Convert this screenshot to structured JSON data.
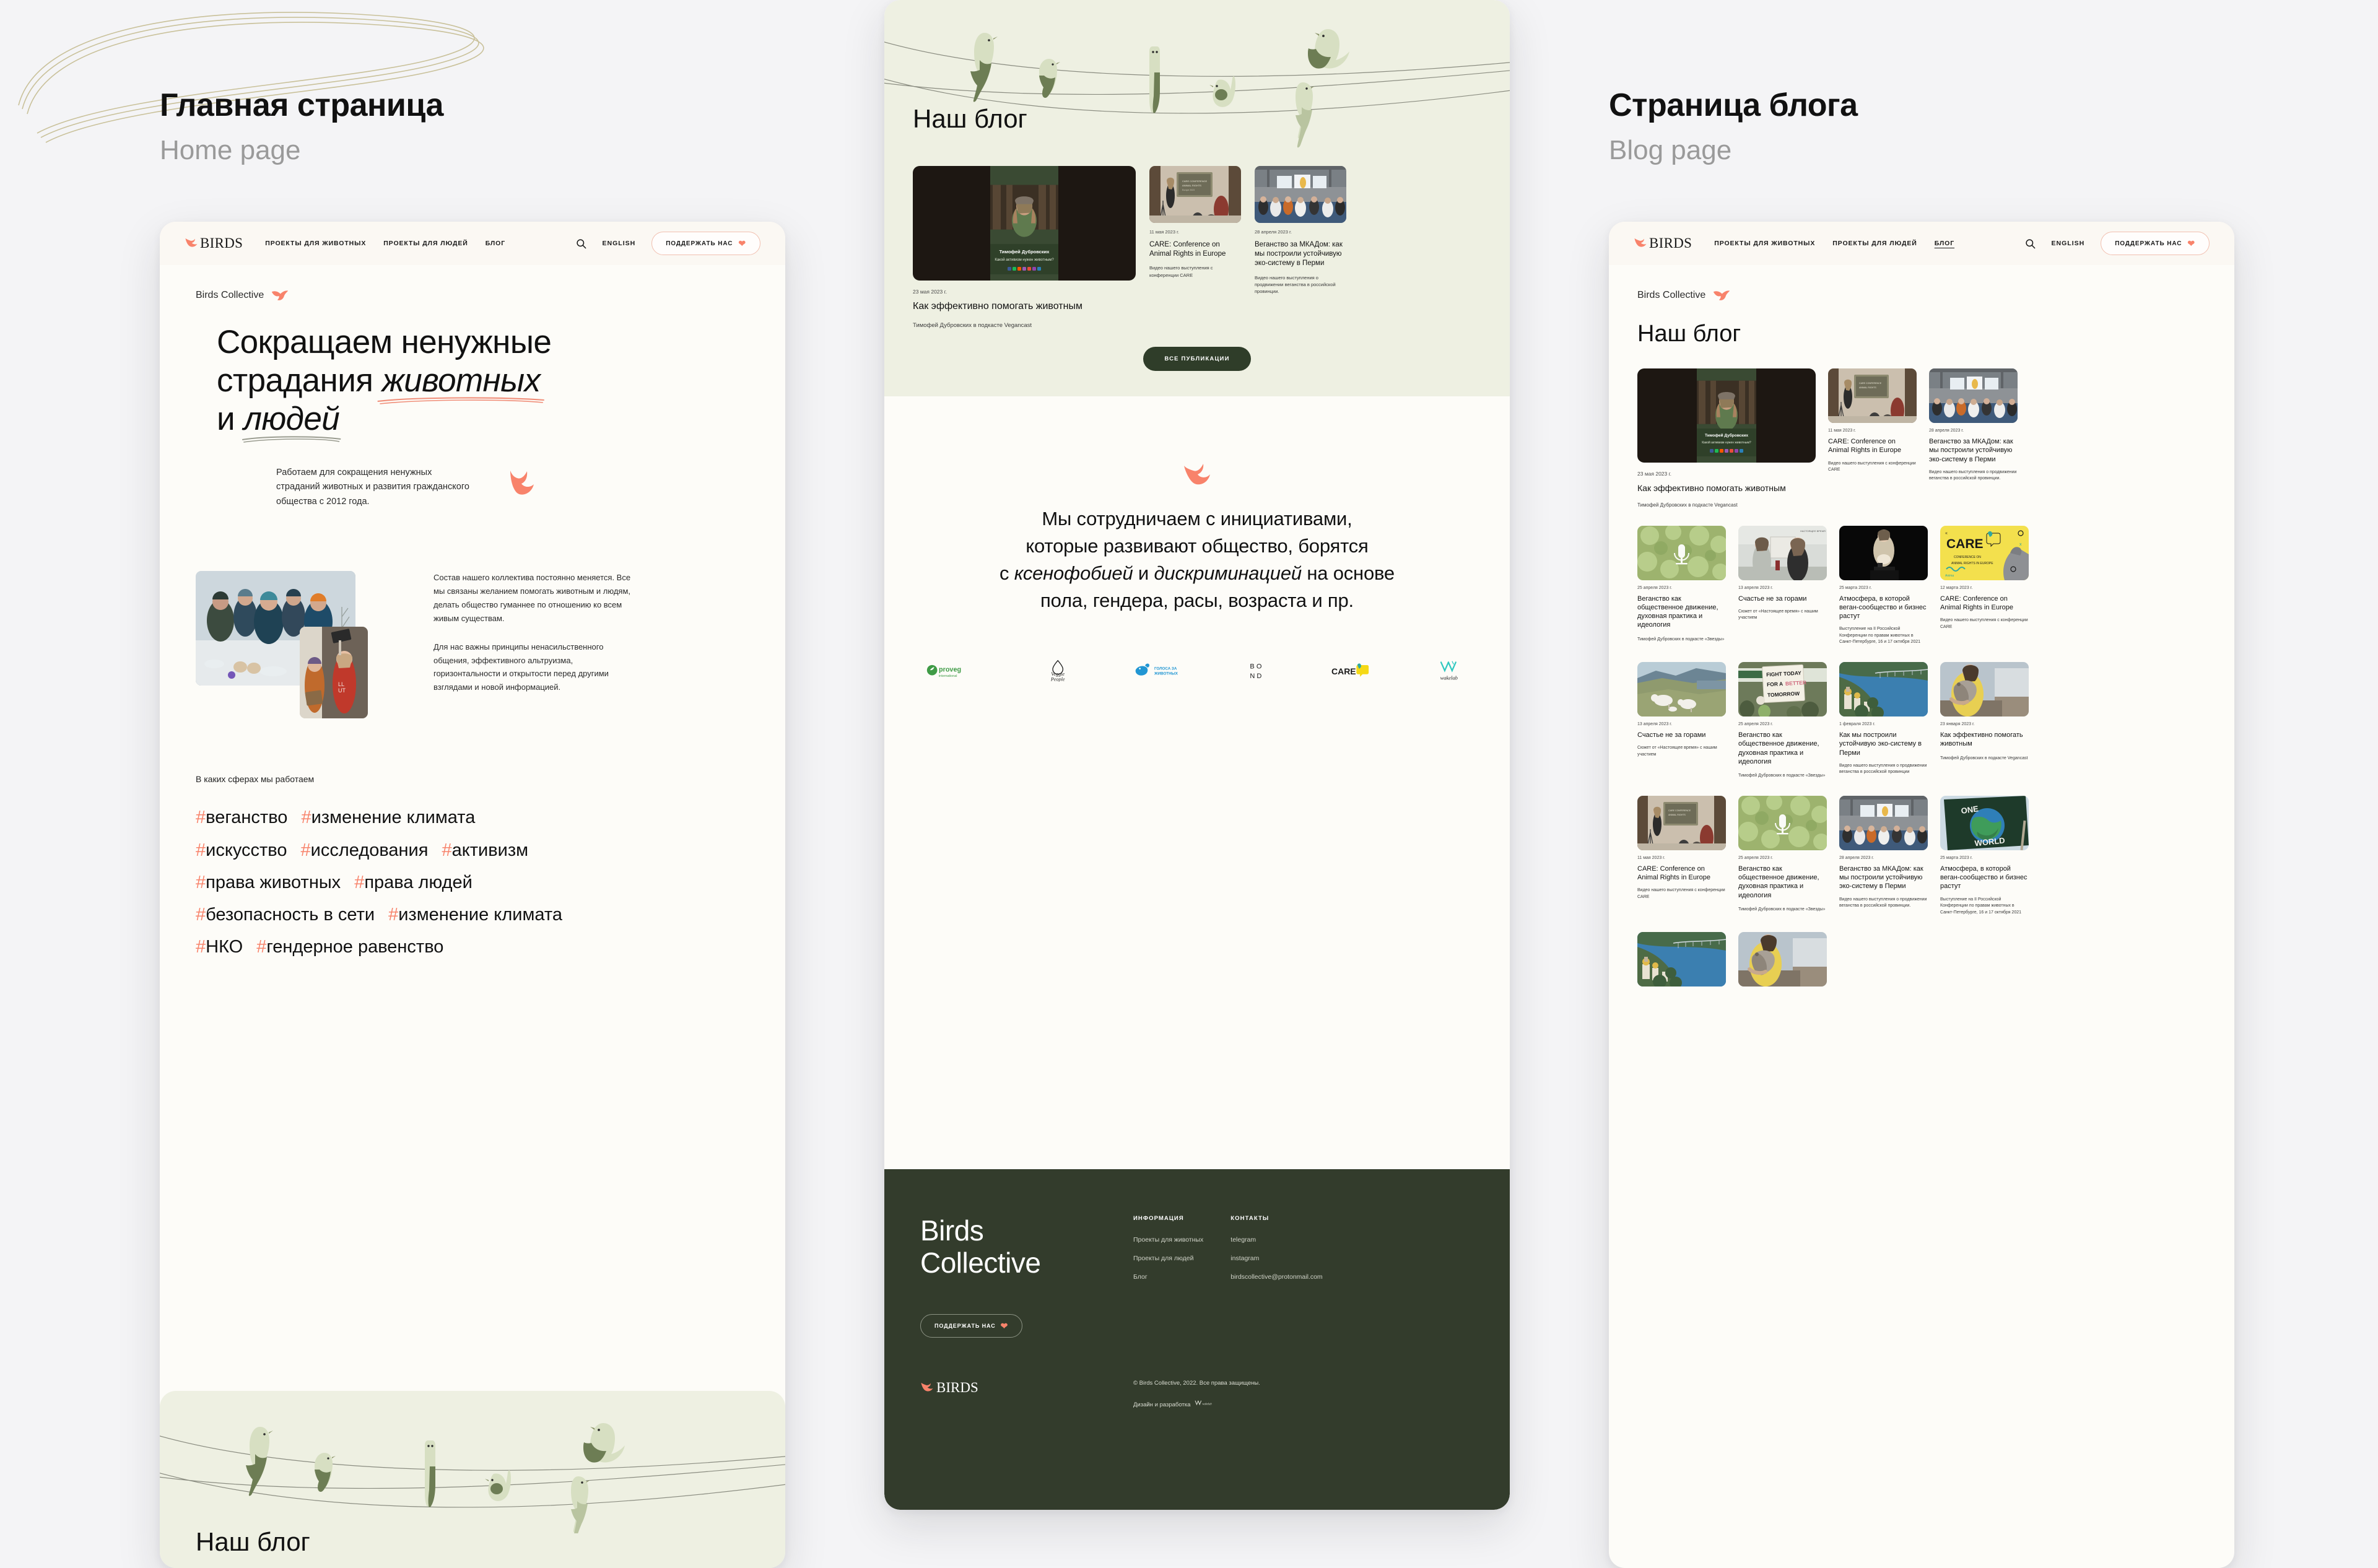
{
  "labels": {
    "home": {
      "title": "Главная страница",
      "subtitle": "Home page"
    },
    "blog": {
      "title": "Страница блога",
      "subtitle": "Blog page"
    }
  },
  "colors": {
    "accent": "#f8836b",
    "dark_green": "#333c2c",
    "pale_green": "#eef0e2",
    "cream": "#fdfcf8",
    "page_bg": "#f4f4f6"
  },
  "header": {
    "logo_text": "BIRDS",
    "logo_icon": "bird-logo-icon",
    "nav": [
      {
        "label": "Проекты для животных",
        "active": false
      },
      {
        "label": "Проекты для людей",
        "active": false
      },
      {
        "label": "Блог",
        "active": false
      }
    ],
    "nav_blogpage": [
      {
        "label": "Проекты для животных",
        "active": false
      },
      {
        "label": "Проекты для людей",
        "active": false
      },
      {
        "label": "Блог",
        "active": true
      }
    ],
    "search_icon": "search-icon",
    "language": "ENGLISH",
    "support_button": "Поддержать нас",
    "heart_icon": "heart-icon"
  },
  "hero": {
    "eyebrow": "Birds Collective",
    "eyebrow_icon": "bird-flying-icon",
    "title_line1": "Сокращаем ненужные",
    "title_line2_plain": "страдания ",
    "title_line2_em": "животных",
    "title_line3_plain": "и ",
    "title_line3_em": "людей",
    "subtitle": "Работаем для сокращения ненужных страданий животных и развития гражданского общества с 2012 года."
  },
  "about": {
    "p1": "Состав нашего коллектива постоянно меняется. Все мы связаны желанием помогать животным и людям, делать общество гуманнее по отношению ко всем живым существам.",
    "p2": "Для нас важны принципы ненасильственного общения, эффективного альтруизма, горизонтальности и открытости перед другими взглядами и новой информацией."
  },
  "tags": {
    "caption": "В каких сферах мы работаем",
    "rows": [
      [
        "веганство",
        "изменение климата"
      ],
      [
        "искусство",
        "исследования",
        "активизм"
      ],
      [
        "права животных",
        "права людей"
      ],
      [
        "безопасность в сети",
        "изменение климата"
      ],
      [
        "НКО",
        "гендерное равенство"
      ]
    ]
  },
  "blog_section": {
    "title": "Наш блог",
    "all_button": "Все публикации",
    "featured": {
      "date": "23 мая 2023 г.",
      "title": "Как эффективно помогать животным",
      "meta": "Тимофей Дубровских в подкасте Vegancast",
      "cover_name": "Тимофей Дубровских",
      "cover_question": "Какой активизм нужен животным?"
    },
    "side_cards": [
      {
        "date": "11 мая 2023 г.",
        "title": "CARE: Conference on Animal Rights in Europe",
        "desc": "Видео нашего выступления с конференции CARE"
      },
      {
        "date": "28 апреля 2023 г.",
        "title": "Веганство за МКАДом: как мы построили устойчивую эко-систему в Перми",
        "desc": "Видео нашего выступления о продвижении веганства в российской провинции."
      }
    ]
  },
  "collab": {
    "icon": "bird-flying-icon",
    "line1": "Мы сотрудничаем с инициативами,",
    "line2": "которые развивают общество, борятся",
    "line3_a": "с ",
    "line3_em1": "ксенофобией",
    "line3_b": " и ",
    "line3_em2": "дискриминацией",
    "line3_c": " на основе",
    "line4": "пола, гендера, расы, возраста и пр.",
    "partners": [
      {
        "name": "proveg international",
        "main": "proveg",
        "sub": "international"
      },
      {
        "name": "Veggie People",
        "main": "Veggie",
        "sub": "People"
      },
      {
        "name": "Голоса за животных",
        "main": "ГОЛОСА ЗА",
        "sub": "ЖИВОТНЫХ"
      },
      {
        "name": "BOND",
        "main": "B O",
        "sub": "N D"
      },
      {
        "name": "CARE",
        "main": "CARE",
        "sub": ""
      },
      {
        "name": "wakelab",
        "main": "wakelab",
        "sub": ""
      }
    ]
  },
  "footer": {
    "brand_line1": "Birds",
    "brand_line2": "Collective",
    "support_button": "Поддержать нас",
    "col_info_title": "Информация",
    "col_info_links": [
      "Проекты для животных",
      "Проекты для людей",
      "Блог"
    ],
    "col_contacts_title": "Контакты",
    "col_contacts_links": [
      "telegram",
      "instagram",
      "birdscollective@protonmail.com"
    ],
    "logo_text": "BIRDS",
    "copyright": "© Birds Collective, 2022. Все права защищены.",
    "credit_label": "Дизайн и разработка",
    "credit_brand": "wakelab"
  },
  "blog_page": {
    "eyebrow": "Birds Collective",
    "title": "Наш блог",
    "featured": {
      "date": "23 мая 2023 г.",
      "title": "Как эффективно помогать животным",
      "meta": "Тимофей Дубровских в подкасте Vegancast",
      "cover_name": "Тимофей Дубровских",
      "cover_question": "Какой активизм нужен животным?"
    },
    "row1": [
      {
        "date": "11 мая 2023 г.",
        "title": "CARE: Conference on Animal Rights in Europe",
        "desc": "Видео нашего выступления с конференции CARE",
        "meta": ""
      },
      {
        "date": "28 апреля 2023 г.",
        "title": "Веганство за МКАДом: как мы построили устойчивую эко-систему в Перми",
        "desc": "Видео нашего выступления о продвижении веганства в российской провинции.",
        "meta": ""
      }
    ],
    "row2": [
      {
        "date": "25 апреля 2023 г.",
        "title": "Веганство как общественное движение, духовная практика и идеология",
        "desc": "",
        "meta": "Тимофей Дубровских в подкасте «Звезды»"
      },
      {
        "date": "13 апреля 2023 г.",
        "title": "Счастье не за горами",
        "desc": "Сюжет от «Настоящее время» с нашим участием",
        "meta": ""
      },
      {
        "date": "25 марта 2023 г.",
        "title": "Атмосфера, в которой веган-сообщество и бизнес растут",
        "desc": "Выступление на II Российской Конференции по правам животных в Санкт-Петербурге, 16 и 17 октября 2021",
        "meta": ""
      },
      {
        "date": "12 марта 2023 г.",
        "title": "CARE: Conference on Animal Rights in Europe",
        "desc": "Видео нашего выступления с конференции CARE",
        "meta": ""
      }
    ],
    "row3": [
      {
        "date": "13 апреля 2023 г.",
        "title": "Счастье не за горами",
        "desc": "Сюжет от «Настоящее время» с нашим участием",
        "meta": ""
      },
      {
        "date": "25 апреля 2023 г.",
        "title": "Веганство как общественное движение, духовная практика и идеология",
        "desc": "",
        "meta": "Тимофей Дубровских в подкасте «Звезды»"
      },
      {
        "date": "1 февраля 2023 г.",
        "title": "Как мы построили устойчивую эко-систему в Перми",
        "desc": "Видео нашего выступления о продвижении веганства в российской провинции",
        "meta": ""
      },
      {
        "date": "23 января 2023 г.",
        "title": "Как эффективно помогать животным",
        "desc": "",
        "meta": "Тимофей Дубровских в подкасте Vegancast"
      }
    ],
    "row4": [
      {
        "date": "11 мая 2023 г.",
        "title": "CARE: Conference on Animal Rights in Europe",
        "desc": "Видео нашего выступления с конференции CARE",
        "meta": ""
      },
      {
        "date": "25 апреля 2023 г.",
        "title": "Веганство как общественное движение, духовная практика и идеология",
        "desc": "",
        "meta": "Тимофей Дубровских в подкасте «Звезды»"
      },
      {
        "date": "28 апреля 2023 г.",
        "title": "Веганство за МКАДом: как мы построили устойчивую эко-систему в Перми",
        "desc": "Видео нашего выступления о продвижении веганства в российской провинции.",
        "meta": ""
      },
      {
        "date": "25 марта 2023 г.",
        "title": "Атмосфера, в которой веган-сообщество и бизнес растут",
        "desc": "Выступление на II Российской Конференции по правам животных в Санкт-Петербурге, 16 и 17 октября 2021",
        "meta": ""
      }
    ]
  }
}
